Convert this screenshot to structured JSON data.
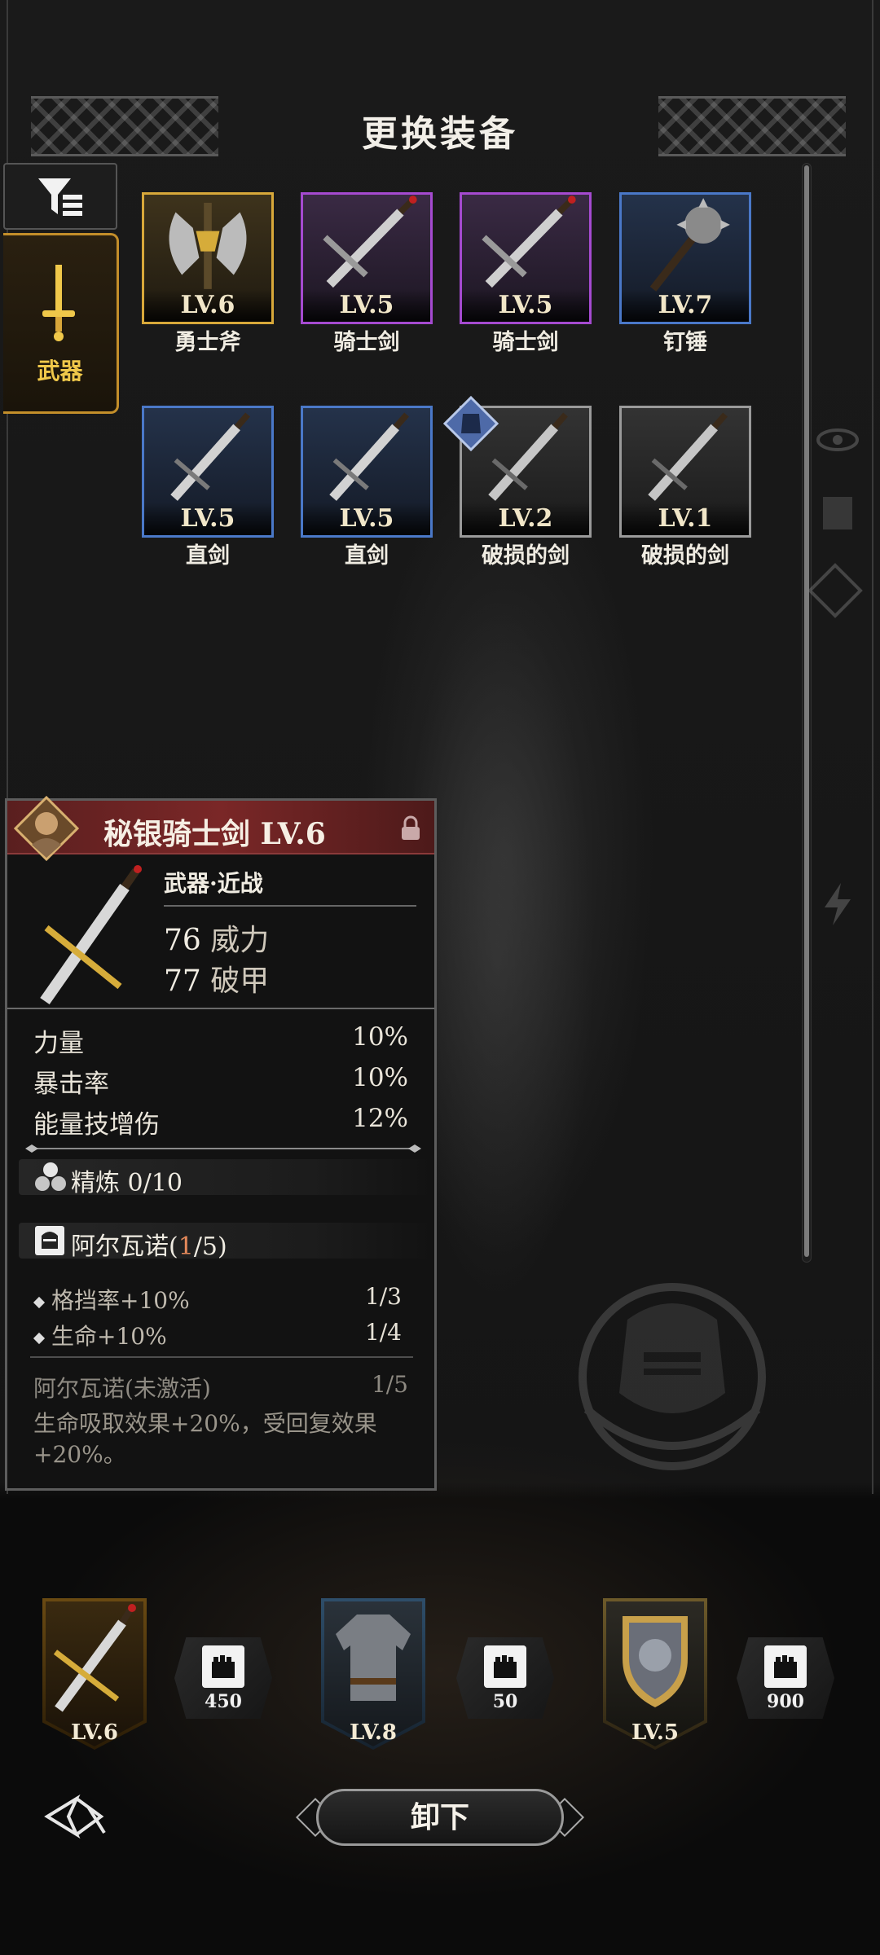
{
  "header": {
    "title": "更换装备"
  },
  "sidebar": {
    "filter_icon": "filter-icon",
    "category_label": "武器",
    "category_icon": "sword-icon"
  },
  "grid": {
    "items": [
      {
        "level": "LV.6",
        "name": "勇士斧",
        "rarity": "gold",
        "icon": "axe-icon"
      },
      {
        "level": "LV.5",
        "name": "骑士剑",
        "rarity": "purple",
        "icon": "knight-sword-icon"
      },
      {
        "level": "LV.5",
        "name": "骑士剑",
        "rarity": "purple",
        "icon": "knight-sword-icon"
      },
      {
        "level": "LV.7",
        "name": "钉锤",
        "rarity": "blue",
        "icon": "mace-icon"
      },
      {
        "level": "LV.5",
        "name": "直剑",
        "rarity": "blue",
        "icon": "straight-sword-icon"
      },
      {
        "level": "LV.5",
        "name": "直剑",
        "rarity": "blue",
        "icon": "straight-sword-icon"
      },
      {
        "level": "LV.2",
        "name": "破损的剑",
        "rarity": "gray",
        "icon": "broken-sword-icon"
      },
      {
        "level": "LV.1",
        "name": "破损的剑",
        "rarity": "gray",
        "icon": "broken-sword-icon"
      }
    ]
  },
  "detail": {
    "name": "秘银骑士剑 LV.6",
    "type": "武器·近战",
    "power_value": "76",
    "power_label": "威力",
    "pierce_value": "77",
    "pierce_label": "破甲",
    "attributes": [
      {
        "label": "力量",
        "value": "10%"
      },
      {
        "label": "暴击率",
        "value": "10%"
      },
      {
        "label": "能量技增伤",
        "value": "12%"
      }
    ],
    "refine": "精炼 0/10",
    "set_name": "阿尔瓦诺(",
    "set_count": "1",
    "set_total": "/5)",
    "set_bonuses": [
      {
        "label": "格挡率+10%",
        "value": "1/3"
      },
      {
        "label": "生命+10%",
        "value": "1/4"
      }
    ],
    "set_full_title": "阿尔瓦诺(未激活)",
    "set_full_value": "1/5",
    "set_full_desc": "生命吸取效果+20%，受回复效果+20%。"
  },
  "equipped": {
    "slots": [
      {
        "level": "LV.6",
        "power": "450",
        "icon": "mithril-sword-icon"
      },
      {
        "level": "LV.8",
        "power": "50",
        "icon": "chainmail-icon"
      },
      {
        "level": "LV.5",
        "power": "900",
        "icon": "lion-shield-icon"
      }
    ]
  },
  "footer": {
    "unequip_label": "卸下",
    "back_icon": "back-icon"
  },
  "colors": {
    "gold": "#d8a83a",
    "purple": "#a54ad0",
    "blue": "#4a78c8",
    "gray": "#9a9a9a",
    "header_red": "#7a2727",
    "accent_orange": "#e3885a"
  }
}
